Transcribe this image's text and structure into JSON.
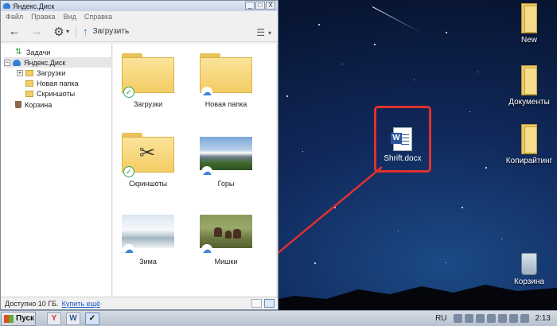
{
  "window": {
    "title": "Яндекс.Диск",
    "controls": {
      "minimize": "_",
      "maximize": "□",
      "close": "X"
    },
    "menu": [
      "Файл",
      "Правка",
      "Вид",
      "Справка"
    ],
    "toolbar": {
      "upload_label": "Загрузить"
    },
    "sidebar": {
      "items": [
        {
          "label": "Задачи"
        },
        {
          "label": "Яндекс.Диск",
          "expander": "−"
        },
        {
          "label": "Загрузки",
          "expander": "+"
        },
        {
          "label": "Новая папка"
        },
        {
          "label": "Скриншоты"
        },
        {
          "label": "Корзина"
        }
      ]
    },
    "tiles": [
      {
        "name": "Загрузки",
        "status": "synced"
      },
      {
        "name": "Новая папка",
        "status": "cloud"
      },
      {
        "name": "Скриншоты",
        "status": "synced"
      },
      {
        "name": "Горы",
        "status": "cloud"
      },
      {
        "name": "Зима",
        "status": "cloud"
      },
      {
        "name": "Мишки",
        "status": "cloud"
      }
    ],
    "status": {
      "free_space": "Доступно 10 ГБ.",
      "buy_link": "Купить ещё"
    }
  },
  "desktop": {
    "icons": [
      {
        "label": "New"
      },
      {
        "label": "Документы"
      },
      {
        "label": "Копирайтинг"
      },
      {
        "label": "Корзина"
      }
    ],
    "highlighted_file": {
      "label": "Shrift.docx"
    },
    "accent_color": "#e03131"
  },
  "taskbar": {
    "start_label": "Пуск",
    "quick_launch": [
      {
        "label": "Y"
      },
      {
        "label": "W"
      },
      {
        "label": "✓"
      }
    ],
    "tray_language": "RU",
    "clock": "2:13"
  }
}
